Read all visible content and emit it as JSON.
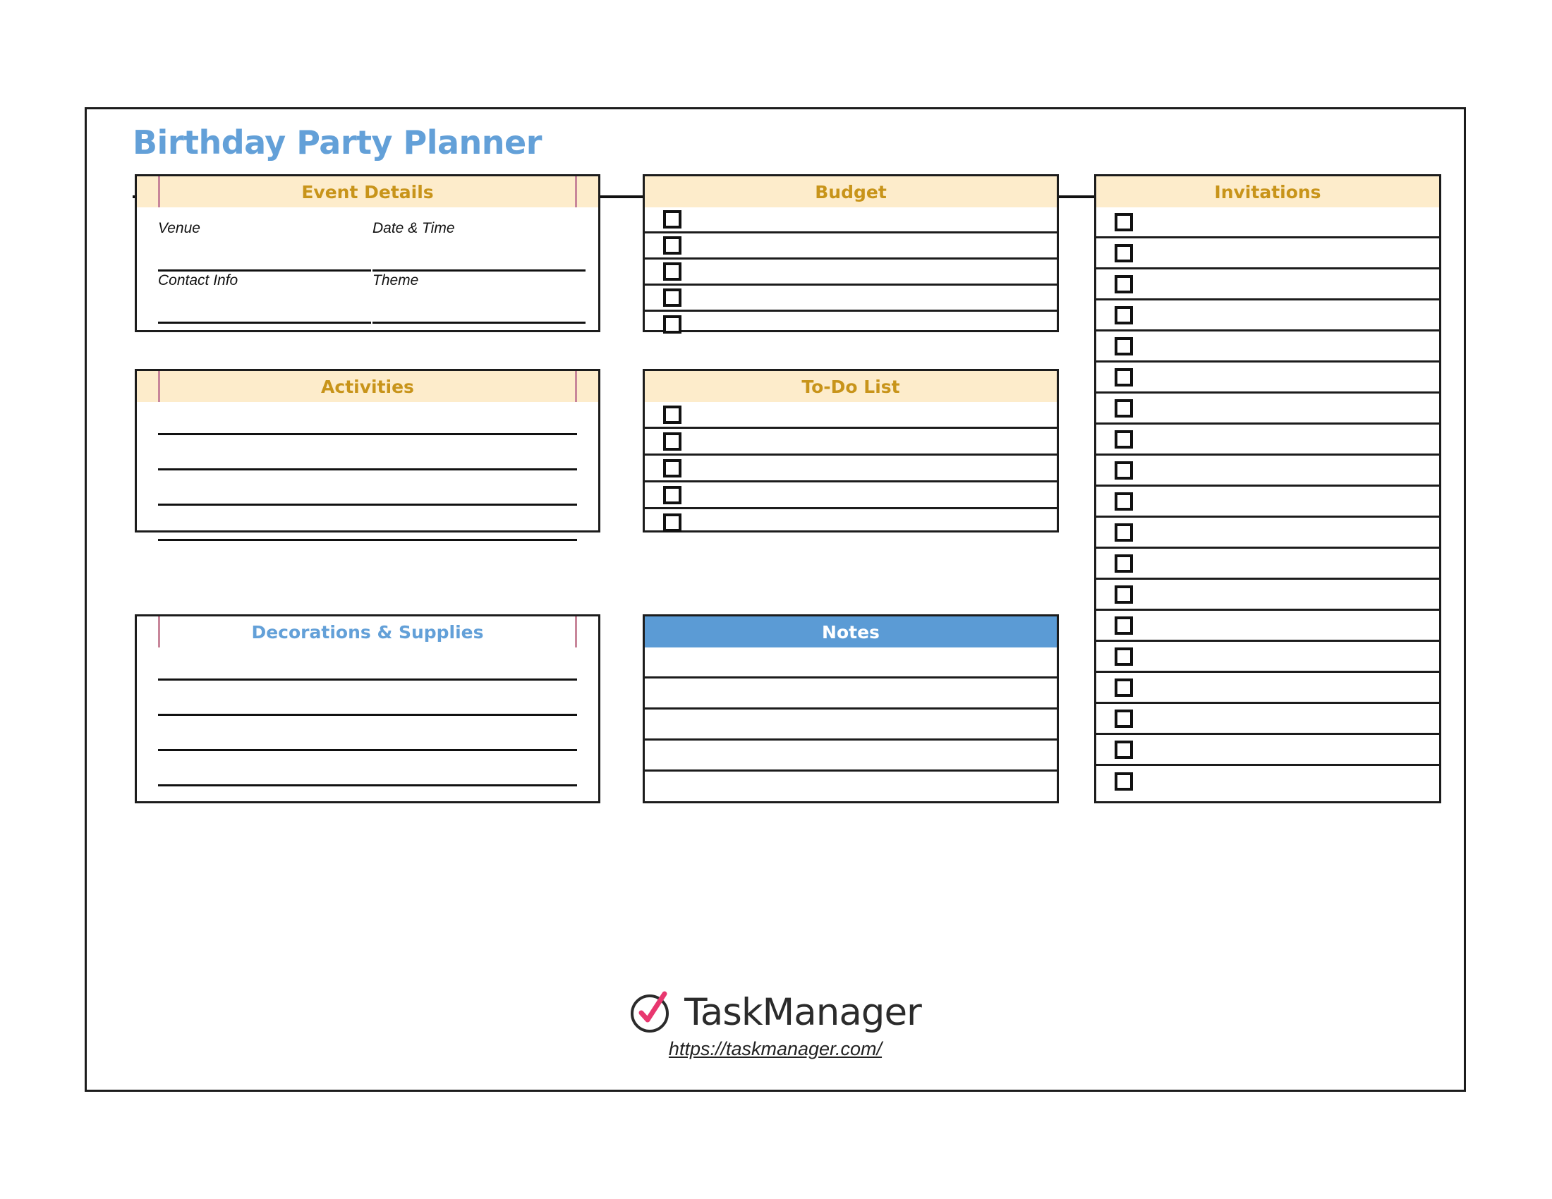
{
  "document": {
    "title": "Birthday Party Planner"
  },
  "colors": {
    "title_blue": "#63a0d8",
    "header_cream": "#fdeccb",
    "header_gold_text": "#c8941a",
    "notes_blue": "#5b9bd5",
    "pink_accent": "#c8869a",
    "logo_pink": "#e8376f",
    "ink": "#1c1c1c"
  },
  "sections": {
    "event_details": {
      "title": "Event Details",
      "header_style": "cream",
      "text_color": "gold",
      "pink_bars": true,
      "fields": [
        {
          "label": "Venue"
        },
        {
          "label": "Date & Time"
        },
        {
          "label": "Contact Info"
        },
        {
          "label": "Theme"
        }
      ]
    },
    "activities": {
      "title": "Activities",
      "header_style": "cream",
      "text_color": "gold",
      "pink_bars": true,
      "line_count": 4
    },
    "decorations": {
      "title": "Decorations & Supplies",
      "header_style": "plain",
      "text_color": "blue",
      "pink_bars": true,
      "line_count": 4
    },
    "budget": {
      "title": "Budget",
      "header_style": "cream",
      "text_color": "gold",
      "pink_bars": false,
      "row_count": 5,
      "has_checkbox": true
    },
    "todo": {
      "title": "To-Do List",
      "header_style": "cream",
      "text_color": "gold",
      "pink_bars": false,
      "row_count": 5,
      "has_checkbox": true
    },
    "notes": {
      "title": "Notes",
      "header_style": "blue",
      "text_color": "white",
      "pink_bars": false,
      "row_count": 5,
      "has_checkbox": false
    },
    "invitations": {
      "title": "Invitations",
      "header_style": "cream",
      "text_color": "gold",
      "pink_bars": false,
      "row_count": 19,
      "has_checkbox": true
    }
  },
  "footer": {
    "brand": "TaskManager",
    "url": "https://taskmanager.com/",
    "logo_icon": "circle-check-icon"
  }
}
